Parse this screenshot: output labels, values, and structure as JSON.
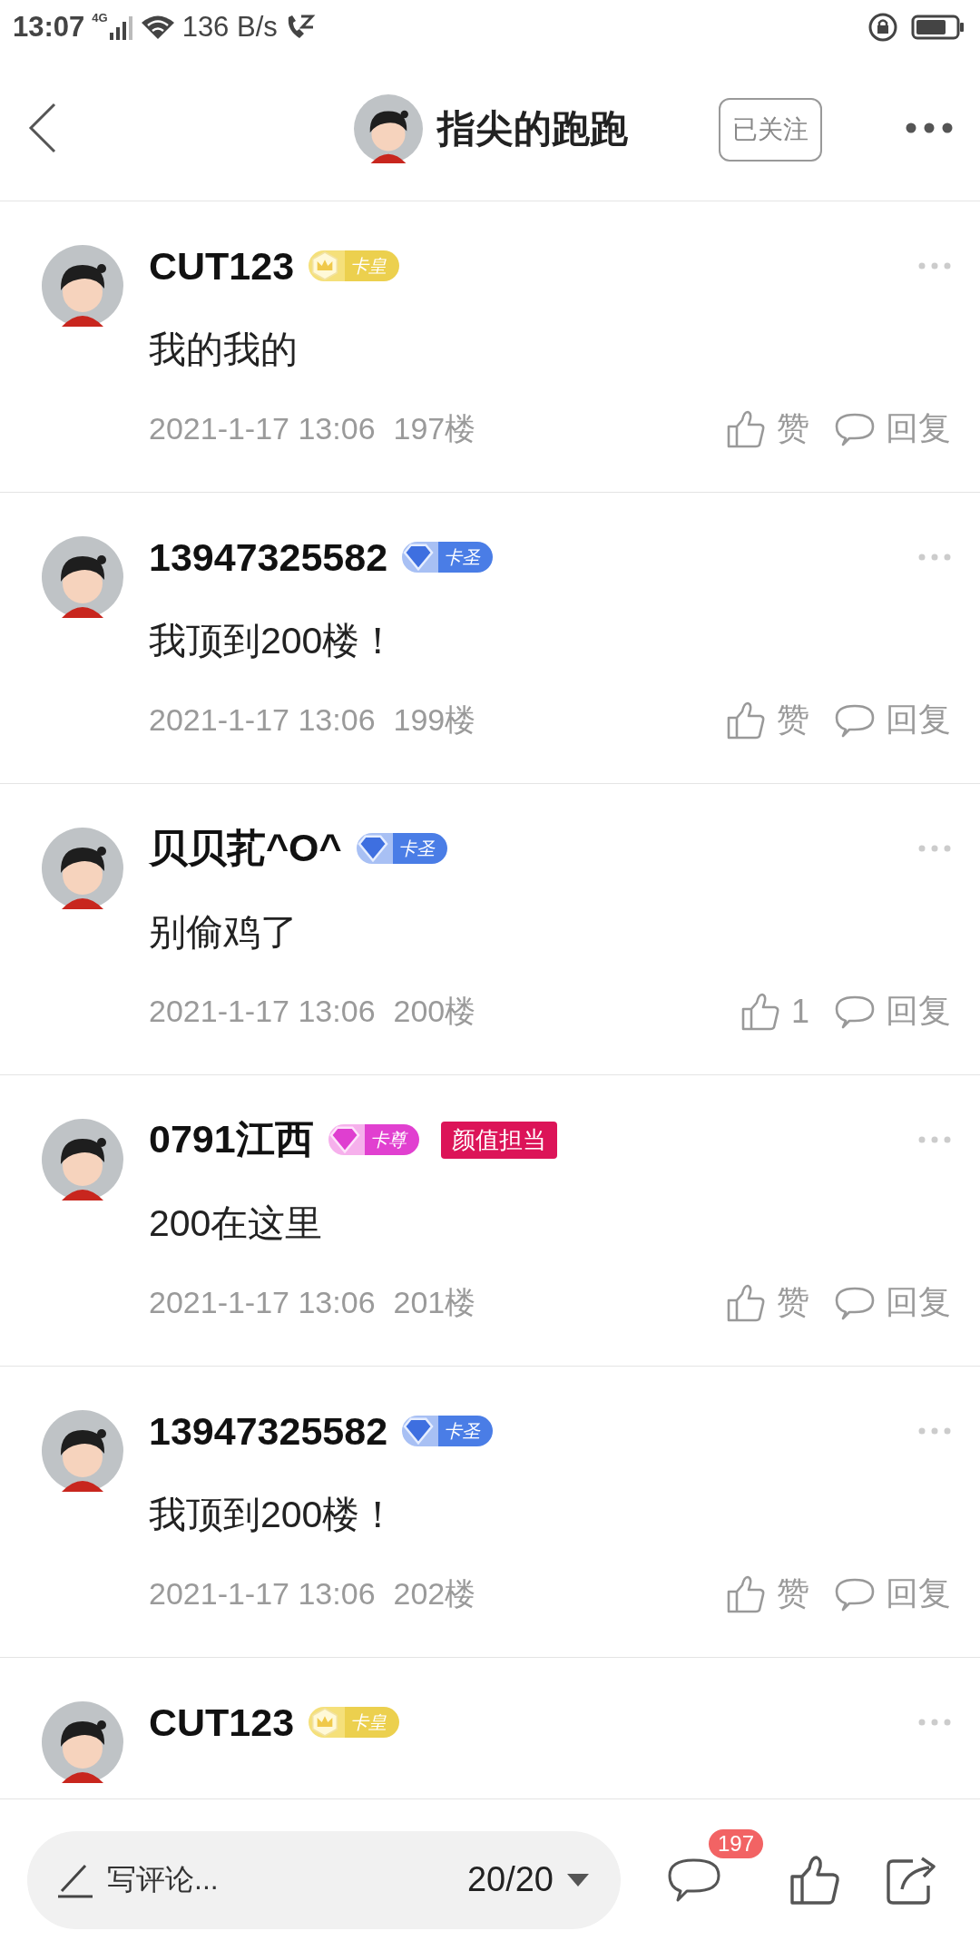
{
  "status_bar": {
    "time": "13:07",
    "network": "4G",
    "speed": "136 B/s"
  },
  "header": {
    "title": "指尖的跑跑",
    "follow_label": "已关注"
  },
  "comments": [
    {
      "name": "CUT123",
      "level": {
        "kind": "crown",
        "label": "卡皇"
      },
      "content": "我的我的",
      "time": "2021-1-17 13:06",
      "floor": "197楼",
      "like_label": "赞",
      "reply_label": "回复"
    },
    {
      "name": "13947325582",
      "level": {
        "kind": "sapphire",
        "label": "卡圣"
      },
      "content": "我顶到200楼！",
      "time": "2021-1-17 13:06",
      "floor": "199楼",
      "like_label": "赞",
      "reply_label": "回复"
    },
    {
      "name": "贝贝芤^O^",
      "level": {
        "kind": "sapphire",
        "label": "卡圣"
      },
      "content": "别偷鸡了",
      "time": "2021-1-17 13:06",
      "floor": "200楼",
      "like_label": "1",
      "reply_label": "回复"
    },
    {
      "name": "0791江西",
      "level": {
        "kind": "amethyst",
        "label": "卡尊"
      },
      "title_badge": "颜值担当",
      "content": "200在这里",
      "time": "2021-1-17 13:06",
      "floor": "201楼",
      "like_label": "赞",
      "reply_label": "回复"
    },
    {
      "name": "13947325582",
      "level": {
        "kind": "sapphire",
        "label": "卡圣"
      },
      "content": "我顶到200楼！",
      "time": "2021-1-17 13:06",
      "floor": "202楼",
      "like_label": "赞",
      "reply_label": "回复"
    },
    {
      "name": "CUT123",
      "level": {
        "kind": "crown",
        "label": "卡皇"
      }
    }
  ],
  "bottom_bar": {
    "placeholder": "写评论...",
    "page": "20/20",
    "comment_count": "197"
  }
}
